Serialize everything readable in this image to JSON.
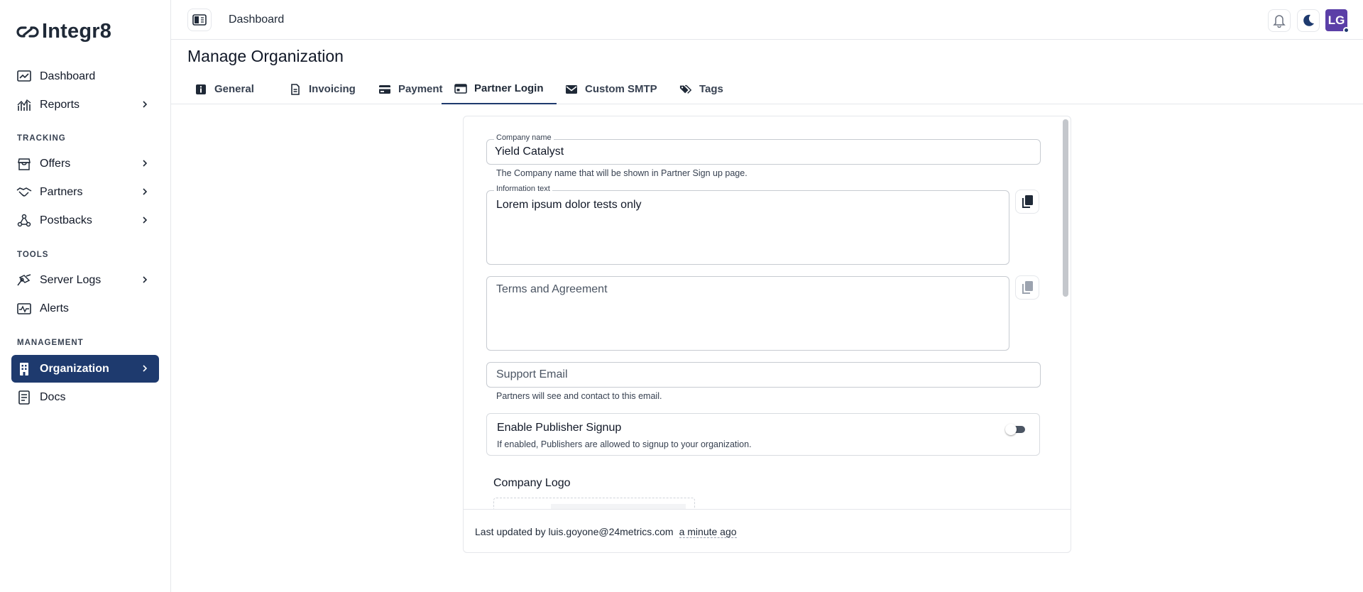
{
  "brand": {
    "name": "Integr8"
  },
  "sidebar": {
    "items": [
      {
        "label": "Dashboard",
        "icon": "dashboard-icon"
      },
      {
        "label": "Reports",
        "icon": "reports-icon"
      },
      {
        "label": "Offers",
        "icon": "offers-icon"
      },
      {
        "label": "Partners",
        "icon": "partners-icon"
      },
      {
        "label": "Postbacks",
        "icon": "postbacks-icon"
      },
      {
        "label": "Server Logs",
        "icon": "server-logs-icon"
      },
      {
        "label": "Alerts",
        "icon": "alerts-icon"
      },
      {
        "label": "Organization",
        "icon": "organization-icon",
        "active": true
      },
      {
        "label": "Docs",
        "icon": "docs-icon"
      }
    ],
    "sections": {
      "tracking": "TRACKING",
      "tools": "TOOLS",
      "management": "MANAGEMENT"
    }
  },
  "topbar": {
    "breadcrumb": "Dashboard",
    "avatar_initials": "LG"
  },
  "page": {
    "title": "Manage Organization"
  },
  "tabs": [
    {
      "label": "General",
      "icon": "info-icon"
    },
    {
      "label": "Invoicing",
      "icon": "invoice-icon"
    },
    {
      "label": "Payment",
      "icon": "card-icon"
    },
    {
      "label": "Partner Login",
      "icon": "login-card-icon",
      "active": true
    },
    {
      "label": "Custom SMTP",
      "icon": "mail-icon"
    },
    {
      "label": "Tags",
      "icon": "tags-icon"
    }
  ],
  "form": {
    "company_name": {
      "label": "Company name",
      "value": "Yield Catalyst",
      "helper": "The Company name that will be shown in Partner Sign up page."
    },
    "information_text": {
      "label": "Information text",
      "value": "Lorem ipsum dolor tests only"
    },
    "terms": {
      "placeholder": "Terms and Agreement"
    },
    "support_email": {
      "placeholder": "Support Email",
      "helper": "Partners will see and contact to this email."
    },
    "signup": {
      "title": "Enable Publisher Signup",
      "description": "If enabled, Publishers are allowed to signup to your organization.",
      "enabled": false
    },
    "company_logo": {
      "label": "Company Logo"
    }
  },
  "footer": {
    "updated_by": "Last updated by luis.goyone@24metrics.com",
    "ago": "a minute ago"
  },
  "colors": {
    "accent": "#1e3a6e",
    "avatar": "#5b3fa7",
    "border": "#e5e7eb"
  }
}
